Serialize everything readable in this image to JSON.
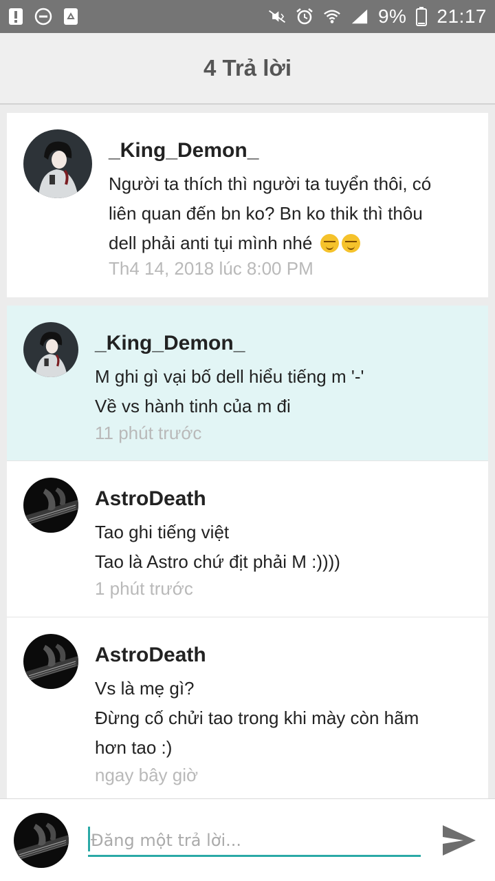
{
  "status_bar": {
    "battery": "9%",
    "time": "21:17",
    "left_icons": [
      "alert-icon",
      "do-not-disturb-icon",
      "recycle-icon"
    ],
    "right_icons": [
      "mute-vibrate-icon",
      "alarm-icon",
      "wifi-icon",
      "signal-icon",
      "battery-icon"
    ]
  },
  "header": {
    "title": "4 Trả lời"
  },
  "root_comment": {
    "author": "_King_Demon_",
    "lines": [
      "Người ta thích thì người ta tuyển thôi, có",
      "liên quan đến bn ko? Bn ko thik thì thôu",
      "dell phải anti tụi mình nhé"
    ],
    "emojis": [
      "smirk-emoji",
      "smirk-emoji"
    ],
    "time": "Th4 14, 2018 lúc 8:00 PM"
  },
  "replies": [
    {
      "author": "_King_Demon_",
      "lines": [
        "M ghi gì vại bố dell hiểu tiếng m '-'",
        "Về vs hành tinh của m đi"
      ],
      "time": "11 phút trước",
      "highlighted": true
    },
    {
      "author": "AstroDeath",
      "lines": [
        "Tao ghi tiếng việt",
        "Tao là Astro chứ địt phải M :))))"
      ],
      "time": "1 phút trước"
    },
    {
      "author": "AstroDeath",
      "lines": [
        "Vs là mẹ gì?",
        "Đừng cố chửi tao trong khi mày còn hãm",
        "hơn tao :)"
      ],
      "time": "ngay bây giờ"
    }
  ],
  "composer": {
    "placeholder": "Đăng một trả lời...",
    "value": "",
    "send_icon": "send-icon"
  },
  "colors": {
    "status_bar": "#757575",
    "header_bg": "#efefef",
    "highlight_bg": "#e2f5f5",
    "accent": "#2aa9a6",
    "timestamp": "#b9b9b9"
  }
}
